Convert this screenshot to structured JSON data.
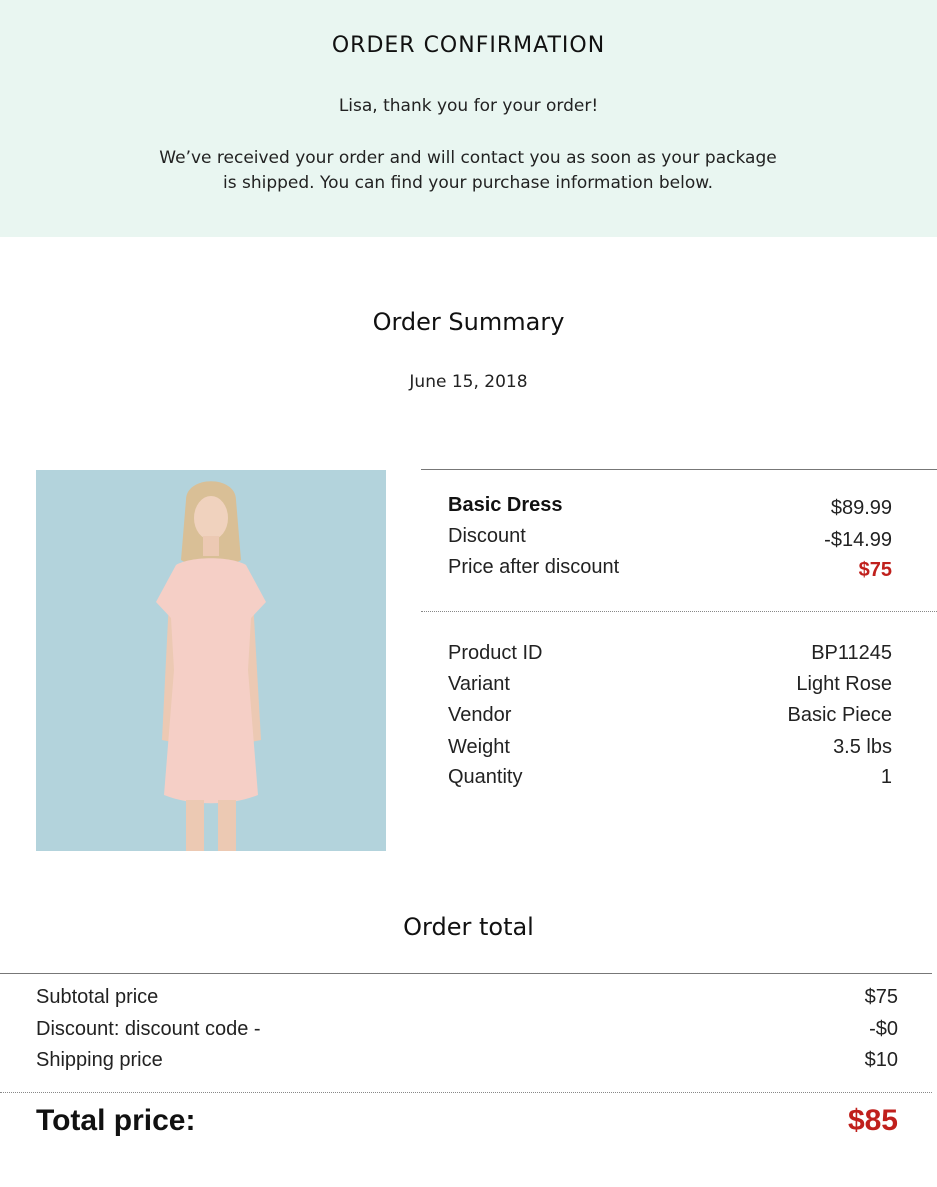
{
  "header": {
    "title": "ORDER CONFIRMATION",
    "greeting": "Lisa, thank you for your order!",
    "message_line1": "We’ve received your order and will contact you as soon as your package",
    "message_line2": "is shipped. You can find your purchase information below."
  },
  "summary": {
    "title": "Order Summary",
    "date": "June 15, 2018"
  },
  "product": {
    "name": "Basic Dress",
    "price": "$89.99",
    "discount_label": "Discount",
    "discount_value": "-$14.99",
    "after_label": "Price after discount",
    "after_value": "$75",
    "details": [
      {
        "label": "Product ID",
        "value": "BP11245"
      },
      {
        "label": "Variant",
        "value": "Light Rose"
      },
      {
        "label": "Vendor",
        "value": "Basic Piece"
      },
      {
        "label": "Weight",
        "value": "3.5 lbs"
      },
      {
        "label": "Quantity",
        "value": "1"
      }
    ]
  },
  "totals": {
    "title": "Order total",
    "rows": [
      {
        "label": "Subtotal price",
        "value": "$75"
      },
      {
        "label": "Discount: discount code -",
        "value": "-$0"
      },
      {
        "label": "Shipping price",
        "value": "$10"
      }
    ],
    "total_label": "Total price:",
    "total_value": "$85"
  },
  "colors": {
    "header_bg": "#e9f6f1",
    "accent_red": "#c0201c",
    "image_bg": "#b3d3dc",
    "dress": "#f5cfc6"
  }
}
